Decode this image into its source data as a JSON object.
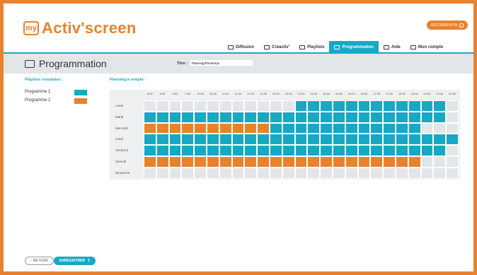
{
  "app": {
    "logo_badge": "my",
    "logo_text": "Activ'screen",
    "logout_label": "DECONNEXION"
  },
  "nav": {
    "items": [
      {
        "label": "Diffusion",
        "icon": "play-icon"
      },
      {
        "label": "Créactiv'",
        "icon": "pencil-icon"
      },
      {
        "label": "Playlists",
        "icon": "playlist-icon"
      },
      {
        "label": "Programmation",
        "icon": "calendar-icon"
      },
      {
        "label": "Aide",
        "icon": "help-icon"
      },
      {
        "label": "Mon compte",
        "icon": "user-icon"
      }
    ],
    "active_index": 3
  },
  "page": {
    "title": "Programmation",
    "title_field_label": "Titre :",
    "title_field_value": "Planning/Printemps"
  },
  "playlists": {
    "label": "Playlists existantes :",
    "items": [
      {
        "name": "Programme 1",
        "color": "#17a8c4"
      },
      {
        "name": "Programme 2",
        "color": "#e8822e"
      }
    ]
  },
  "planning": {
    "label": "Planning à remplir :",
    "hours": [
      "8:00",
      "8:30",
      "9:00",
      "9:30",
      "10:00",
      "10:30",
      "11:00",
      "11:30",
      "12:00",
      "12:30",
      "13:00",
      "13:30",
      "14:00",
      "14:30",
      "15:00",
      "15:30",
      "16:00",
      "16:30",
      "17:00",
      "17:30",
      "18:00",
      "18:30",
      "19:00",
      "19:30",
      "20:00"
    ],
    "days": [
      {
        "name": "Lundi",
        "cells": "0000000000001111111111110"
      },
      {
        "name": "Mardi",
        "cells": "1111111111111111111111110"
      },
      {
        "name": "Mercredi",
        "cells": "2222222222111111111111000"
      },
      {
        "name": "Jeudi",
        "cells": "1111111111111111111111111"
      },
      {
        "name": "Vendredi",
        "cells": "1111111111111111111111110"
      },
      {
        "name": "Samedi",
        "cells": "2222222222222222222222000"
      },
      {
        "name": "Dimanche",
        "cells": "0000000000000000000000000"
      }
    ],
    "colors": {
      "empty": "#e3e6e8",
      "p1": "#17a8c4",
      "p2": "#e8822e"
    }
  },
  "buttons": {
    "back_label": "RETOUR",
    "save_label": "ENREGISTRER"
  }
}
